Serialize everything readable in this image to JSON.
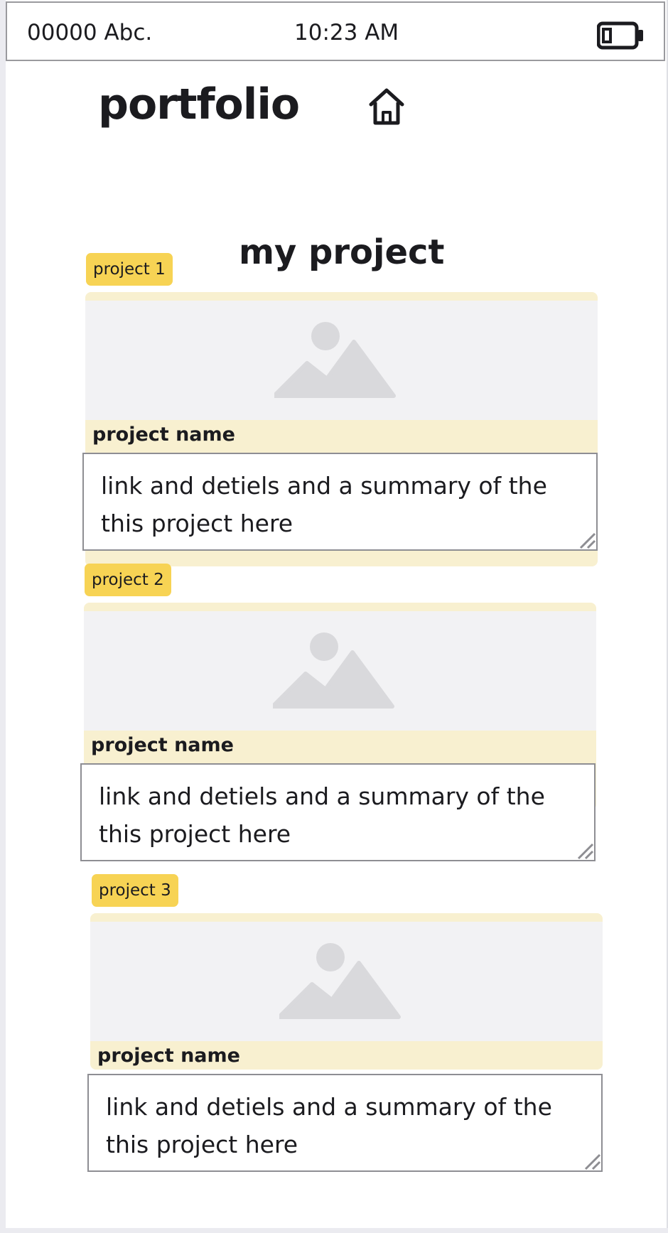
{
  "status_bar": {
    "carrier": "00000 Abc.",
    "time": "10:23 AM",
    "battery_icon": "battery-icon"
  },
  "header": {
    "title": "portfolio",
    "home_icon": "home-icon"
  },
  "section": {
    "title": "my project"
  },
  "projects": [
    {
      "tag": "project 1",
      "name": "project name",
      "description_line1": "link and detiels and a summary of the",
      "description_line2": "this project here",
      "image_icon": "image-placeholder-icon"
    },
    {
      "tag": "project 2",
      "name": "project name",
      "description_line1": "link and detiels and a summary of the",
      "description_line2": "this project here",
      "image_icon": "image-placeholder-icon"
    },
    {
      "tag": "project 3",
      "name": "project name",
      "description_line1": "link and detiels and a summary of the",
      "description_line2": "this project here",
      "image_icon": "image-placeholder-icon"
    }
  ],
  "colors": {
    "tag_yellow": "#f7d354",
    "card_cream": "#f8f0d0",
    "image_placeholder": "#f2f2f4",
    "text": "#1b1b1f",
    "border": "#8e8e93"
  }
}
